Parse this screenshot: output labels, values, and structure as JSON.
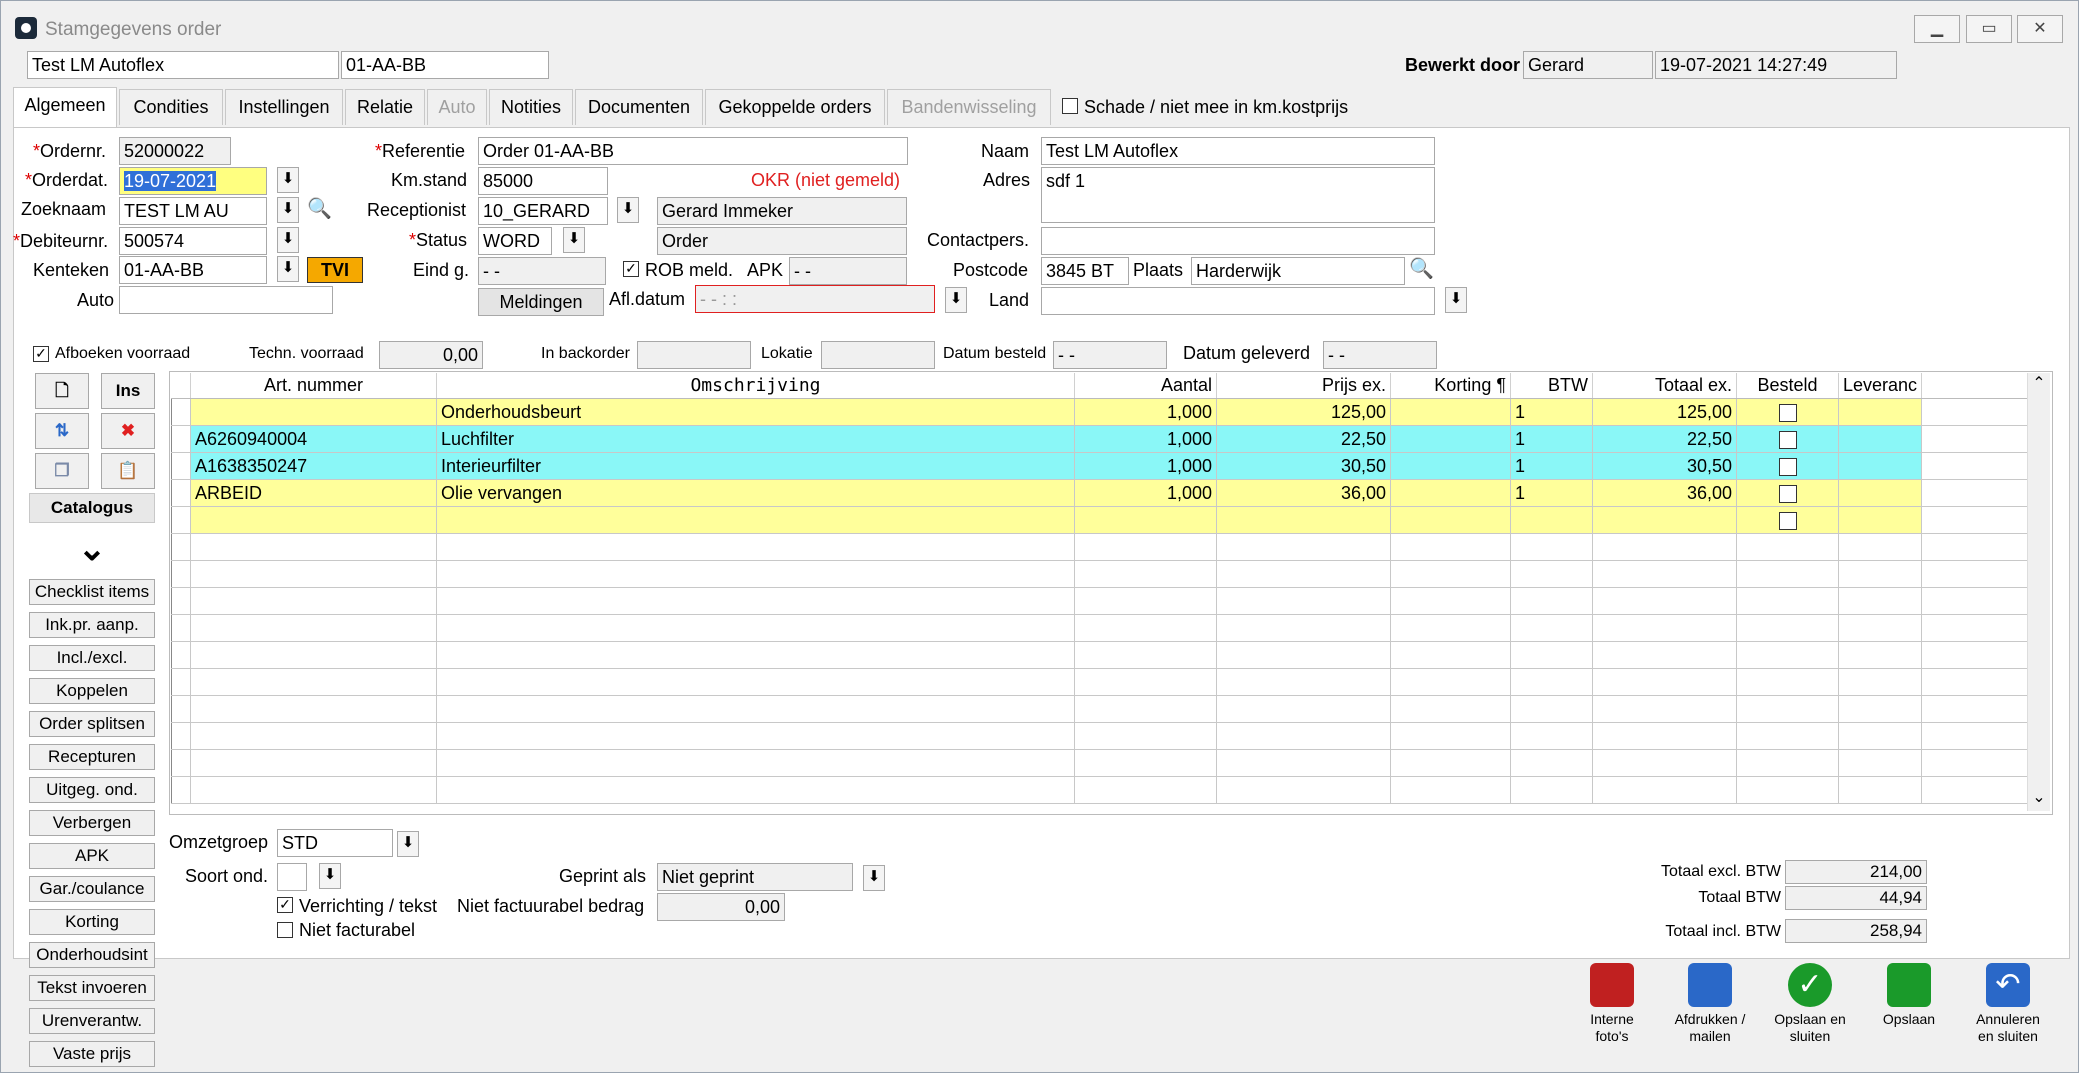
{
  "window": {
    "title": "Stamgegevens order",
    "minimize": "▭",
    "maximize": "▭",
    "close": "✕"
  },
  "header": {
    "customer": "Test LM Autoflex",
    "plate": "01-AA-BB",
    "edited_by_label": "Bewerkt door",
    "edited_by": "Gerard",
    "edited_at": "19-07-2021 14:27:49"
  },
  "tabs": [
    {
      "label": "Algemeen"
    },
    {
      "label": "Condities"
    },
    {
      "label": "Instellingen"
    },
    {
      "label": "Relatie"
    },
    {
      "label": "Auto"
    },
    {
      "label": "Notities"
    },
    {
      "label": "Documenten"
    },
    {
      "label": "Gekoppelde orders"
    },
    {
      "label": "Bandenwisseling"
    }
  ],
  "damage_checkbox": "Schade / niet mee in km.kostprijs",
  "form": {
    "ordernr_label": "Ordernr.",
    "ordernr": "52000022",
    "orderdat_label": "Orderdat.",
    "orderdat": "19-07-2021",
    "zoeknaam_label": "Zoeknaam",
    "zoeknaam": "TEST LM AU",
    "debiteurnr_label": "Debiteurnr.",
    "debiteurnr": "500574",
    "kenteken_label": "Kenteken",
    "kenteken": "01-AA-BB",
    "tvi": "TVI",
    "auto_label": "Auto",
    "auto": "",
    "referentie_label": "Referentie",
    "referentie": "Order 01-AA-BB",
    "kmstand_label": "Km.stand",
    "kmstand": "85000",
    "okr": "OKR (niet gemeld)",
    "receptionist_label": "Receptionist",
    "receptionist": "10_GERARD",
    "receptionist_name": "Gerard Immeker",
    "status_label": "Status",
    "status": "WORD",
    "status_text": "Order",
    "eindg_label": "Eind g.",
    "eindg": "- -",
    "rob_label": "ROB meld.",
    "apk_label": "APK",
    "apk": "- -",
    "meldingen": "Meldingen",
    "afldatum_label": "Afl.datum",
    "afldatum": "- -    : :",
    "naam_label": "Naam",
    "naam": "Test LM Autoflex",
    "adres_label": "Adres",
    "adres": "sdf 1",
    "contact_label": "Contactpers.",
    "contact": "",
    "postcode_label": "Postcode",
    "postcode": "3845 BT",
    "plaats_label": "Plaats",
    "plaats": "Harderwijk",
    "land_label": "Land",
    "land": ""
  },
  "stock": {
    "afboeken": "Afboeken voorraad",
    "techn_label": "Techn. voorraad",
    "techn": "0,00",
    "backorder_label": "In backorder",
    "backorder": "",
    "lokatie_label": "Lokatie",
    "lokatie": "",
    "besteld_label": "Datum besteld",
    "besteld": "- -",
    "geleverd_label": "Datum geleverd",
    "geleverd": "- -"
  },
  "sidebar": {
    "ins": "Ins",
    "catalogus": "Catalogus",
    "buttons": [
      {
        "label": "Checklist items"
      },
      {
        "label": "Ink.pr. aanp."
      },
      {
        "label": "Incl./excl."
      },
      {
        "label": "Koppelen"
      },
      {
        "label": "Order splitsen"
      },
      {
        "label": "Recepturen"
      },
      {
        "label": "Uitgeg. ond."
      },
      {
        "label": "Verbergen"
      },
      {
        "label": "APK"
      },
      {
        "label": "Gar./coulance"
      },
      {
        "label": "Korting"
      },
      {
        "label": "Onderhoudsint"
      },
      {
        "label": "Tekst invoeren"
      },
      {
        "label": "Urenverantw."
      },
      {
        "label": "Vaste prijs"
      }
    ]
  },
  "grid": {
    "columns": [
      "Art. nummer",
      "Omschrijving",
      "Aantal",
      "Prijs ex.",
      "Korting ¶",
      "BTW",
      "Totaal ex.",
      "Besteld",
      "Leveranc"
    ],
    "rows": [
      {
        "art": "",
        "oms": "Onderhoudsbeurt",
        "aantal": "1,000",
        "prijs": "125,00",
        "korting": "",
        "btw": "1",
        "totaal": "125,00",
        "color": "yellow"
      },
      {
        "art": "A6260940004",
        "oms": "Luchfilter",
        "aantal": "1,000",
        "prijs": "22,50",
        "korting": "",
        "btw": "1",
        "totaal": "22,50",
        "color": "cyan"
      },
      {
        "art": "A1638350247",
        "oms": "Interieurfilter",
        "aantal": "1,000",
        "prijs": "30,50",
        "korting": "",
        "btw": "1",
        "totaal": "30,50",
        "color": "cyan"
      },
      {
        "art": "ARBEID",
        "oms": "Olie vervangen",
        "aantal": "1,000",
        "prijs": "36,00",
        "korting": "",
        "btw": "1",
        "totaal": "36,00",
        "color": "yellow"
      },
      {
        "art": "",
        "oms": "",
        "aantal": "",
        "prijs": "",
        "korting": "",
        "btw": "",
        "totaal": "",
        "color": "yellow"
      }
    ]
  },
  "bottom": {
    "omzetgroep_label": "Omzetgroep",
    "omzetgroep": "STD",
    "soort_label": "Soort ond.",
    "soort": "",
    "geprint_label": "Geprint als",
    "geprint": "Niet geprint",
    "verrichting": "Verrichting / tekst",
    "niet_fact_bedrag_label": "Niet factuurabel bedrag",
    "niet_fact_bedrag": "0,00",
    "niet_facturabel": "Niet facturabel"
  },
  "totals": {
    "excl_label": "Totaal excl. BTW",
    "excl": "214,00",
    "btw_label": "Totaal BTW",
    "btw": "44,94",
    "incl_label": "Totaal incl. BTW",
    "incl": "258,94"
  },
  "actions": [
    {
      "label": "Interne foto's",
      "color": "#c02020"
    },
    {
      "label": "Afdrukken / mailen",
      "color": "#2a68c8"
    },
    {
      "label": "Opslaan en sluiten",
      "color": "#1a9a2a"
    },
    {
      "label": "Opslaan",
      "color": "#1a9a2a"
    },
    {
      "label": "Annuleren en sluiten",
      "color": "#2a68c8"
    }
  ]
}
